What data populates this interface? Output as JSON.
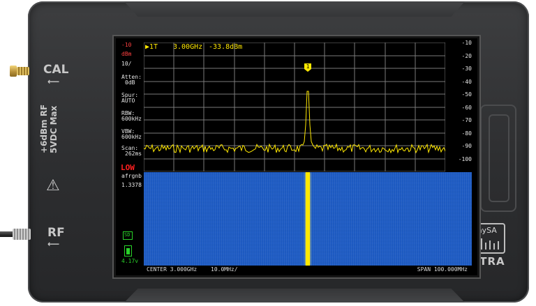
{
  "device": {
    "brand": "tinySA",
    "model": "ULTRA",
    "port_cal": "CAL",
    "port_rf": "RF",
    "side_warning": "+6dBm RF",
    "side_warning2": "5VDC Max"
  },
  "screen": {
    "marker": "▶1T",
    "marker_freq": "3.00GHz",
    "marker_level": "-33.8dBm",
    "marker_number": "1",
    "ref_level": "-10",
    "unit": "dBm",
    "scale": "10/",
    "atten_label": "Atten:",
    "atten_value": "0dB",
    "spur_label": "Spur:",
    "spur_value": "AUTO",
    "rbw_label": "RBW:",
    "rbw_value": "600kHz",
    "vbw_label": "VBW:",
    "vbw_value": "600kHz",
    "scan_label": "Scan:",
    "scan_value": "262ms",
    "mode": "LOW",
    "remote": "afrgnb",
    "remote_val": "1.3378",
    "sd": "SD",
    "battery": "4.17v",
    "y_ticks": [
      "-10",
      "-20",
      "-30",
      "-40",
      "-50",
      "-60",
      "-70",
      "-80",
      "-90",
      "-100"
    ],
    "center": "CENTER 3.000GHz",
    "per_div": "10.0MHz/",
    "span": "SPAN 100.000MHz",
    "trace_color": "#ffe800",
    "waterfall_color": "#1f5fcc",
    "accent_green": "#29d229",
    "mode_color": "#ff2020"
  }
}
